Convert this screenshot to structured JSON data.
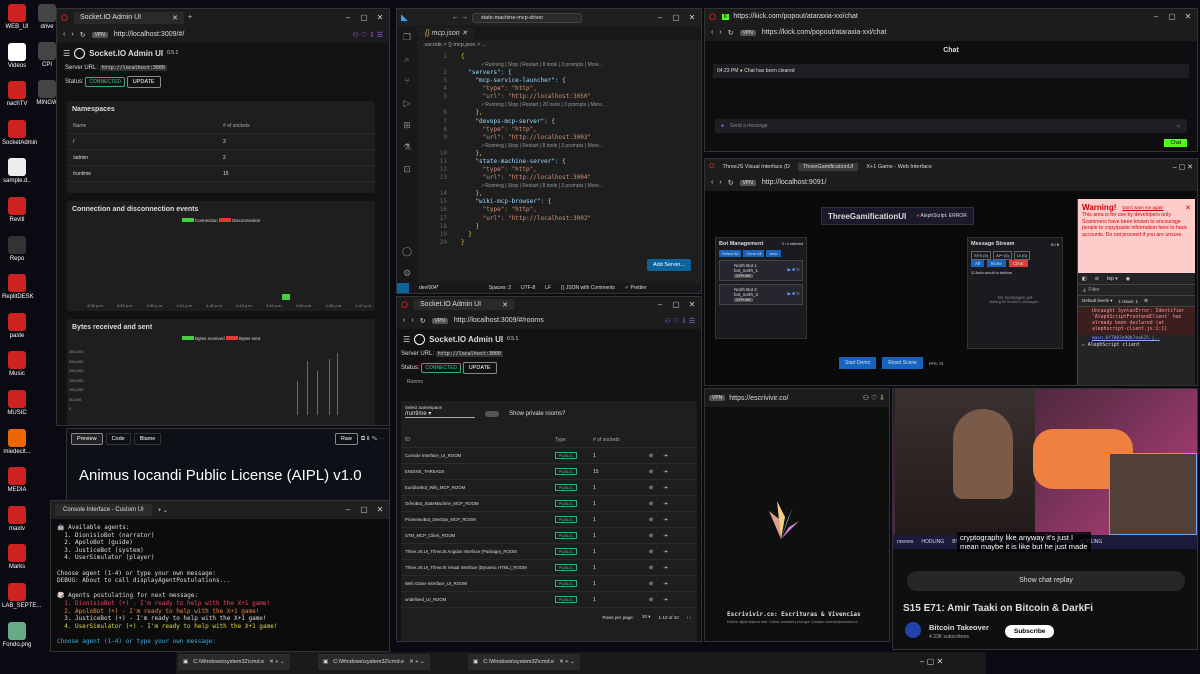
{
  "desktop": {
    "icons": [
      "WEB_UI",
      "Videos",
      "nachTV",
      "SocketAdmin",
      "sample.d..",
      "Revitl",
      "Repo",
      "ReplitDESK",
      "paste",
      "Music",
      "MUSIC",
      "miedecit...",
      "MEDIA",
      "maxtv",
      "Marks",
      "LAB_SEPTE...",
      "Fondo.png"
    ],
    "mid_icons": [
      "drive",
      "CPI",
      "MINGW"
    ]
  },
  "socket_left": {
    "tab": "Socket.IO Admin UI",
    "url": "http://localhost:3009/#/",
    "title": "Socket.IO Admin UI",
    "version": "0.5.1",
    "server_url_label": "Server URL:",
    "server_url": "http://localhost:3000",
    "status_label": "Status:",
    "status": "CONNECTED",
    "update": "UPDATE",
    "namespaces_title": "Namespaces",
    "col_name": "Name",
    "col_sockets": "# of sockets",
    "namespaces": [
      {
        "name": "/",
        "count": "3"
      },
      {
        "name": "/admin",
        "count": "2"
      },
      {
        "name": "/runtime",
        "count": "15"
      }
    ],
    "conn_title": "Connection and disconnection events",
    "legend_conn": "Connection",
    "legend_disc": "Disconnection",
    "bytes_title": "Bytes received and sent",
    "legend_recv": "Bytes received",
    "legend_sent": "Bytes sent",
    "times": [
      "4:38 p.m.",
      "4:39 p.m.",
      "4:40 p.m.",
      "4:41 p.m.",
      "4:42 p.m.",
      "4:43 p.m.",
      "4:44 p.m.",
      "4:45 p.m.",
      "4:46 p.m.",
      "4:47 p.m."
    ],
    "bytes_ticks": [
      "300,000",
      "250,000",
      "200,000",
      "150,000",
      "100,000",
      "50,000",
      "0"
    ]
  },
  "github": {
    "tab_preview": "Preview",
    "tab_code": "Code",
    "tab_blame": "Blame",
    "raw": "Raw",
    "heading": "Animus Iocandi Public License (AIPL) v1.0"
  },
  "vscode": {
    "search": "state-machine-mcp-driver",
    "tab": "mcp.json",
    "breadcrumb": ".vscode > {} mcp.json > ...",
    "lenses": [
      "✓Running | Stop | Restart | 8 tools | 3 prompts | More...",
      "✓Running | Stop | Restart | 20 tools | 3 prompts | More...",
      "✓Running | Stop | Restart | 8 tools | 3 prompts | More...",
      "✓Running | Stop | Restart | 8 tools | 3 prompts | More..."
    ],
    "lines": [
      "{",
      "  \"servers\": {",
      "    \"mcp-service-launcher\": {",
      "      \"type\": \"http\",",
      "      \"url\": \"http://localhost:3050\"",
      "    },",
      "    \"devops-mcp-server\": {",
      "      \"type\": \"http\",",
      "      \"url\": \"http://localhost:3003\"",
      "    },",
      "    \"state-machine-server\": {",
      "      \"type\": \"http\",",
      "      \"url\": \"http://localhost:3004\"",
      "    },",
      "    \"wiki-mcp-browser\": {",
      "      \"type\": \"http\",",
      "      \"url\": \"http://localhost:3002\"",
      "    }",
      "  }",
      "}"
    ],
    "add_server": "Add Server...",
    "status_branch": "dev/004*",
    "status_spaces": "Spaces: 2",
    "status_enc": "UTF-8",
    "status_eol": "LF",
    "status_lang": "{} JSON with Comments",
    "status_prettier": "✓ Prettier"
  },
  "socket_mid": {
    "tab": "Socket.IO Admin UI",
    "url": "http://localhost:3009/#/rooms",
    "title": "Socket.IO Admin UI",
    "version": "0.5.1",
    "server_url_label": "Server URL:",
    "server_url": "http://localhost:3000",
    "status_label": "Status:",
    "status": "CONNECTED",
    "update": "UPDATE",
    "section": "Rooms",
    "ns_label": "Select namespace",
    "ns_value": "/runtime",
    "private_label": "Show private rooms?",
    "col_id": "ID",
    "col_type": "Type",
    "col_sockets": "# of sockets",
    "rooms": [
      {
        "id": "Console Interface_UI_ROOM",
        "type": "PUBLIC",
        "n": "1"
      },
      {
        "id": "ENGINE_THREADS",
        "type": "PUBLIC",
        "n": "15"
      },
      {
        "id": "EuridiceBot_Wiki_MCP_ROOM",
        "type": "PUBLIC",
        "n": "1"
      },
      {
        "id": "OrfeoBot_StateMachine_MCP_ROOM",
        "type": "PUBLIC",
        "n": "1"
      },
      {
        "id": "PrometeoBot_DevOps_MCP_ROOM",
        "type": "PUBLIC",
        "n": "1"
      },
      {
        "id": "STM_MCP_Client_ROOM",
        "type": "PUBLIC",
        "n": "1"
      },
      {
        "id": "Three.JS.UI_ThreeJS Angular Interface (Package)_ROOM",
        "type": "PUBLIC",
        "n": "1"
      },
      {
        "id": "Three.JS.UI_ThreeJS Visual Interface (Dynamic HTML)_ROOM",
        "type": "PUBLIC",
        "n": "1"
      },
      {
        "id": "Web Game Interface_UI_ROOM",
        "type": "PUBLIC",
        "n": "1"
      },
      {
        "id": "undefined_UI_ROOM",
        "type": "PUBLIC",
        "n": "1"
      }
    ],
    "rows_label": "Rows per page:",
    "rows_value": "20",
    "range": "1-10 of 10"
  },
  "console": {
    "title": "Console Interface - Custom UI",
    "lines": [
      {
        "t": "🤖 Available agents:",
        "c": "#ddd"
      },
      {
        "t": "  1. DionisioBot (narrator)",
        "c": "#ddd"
      },
      {
        "t": "  2. ApoloBot (guide)",
        "c": "#ddd"
      },
      {
        "t": "  3. JusticeBot (system)",
        "c": "#ddd"
      },
      {
        "t": "  4. UserSimulator (player)",
        "c": "#ddd"
      },
      {
        "t": "",
        "c": "#ddd"
      },
      {
        "t": "Choose agent (1-4) or type your own message:",
        "c": "#ddd"
      },
      {
        "t": "DEBUG: About to call displayAgentPostulations...",
        "c": "#ddd"
      },
      {
        "t": "",
        "c": "#ddd"
      },
      {
        "t": "🎲 Agents postulating for next message:",
        "c": "#ddd"
      },
      {
        "t": "  1. DionisioBot (+) - I'm ready to help with the X+1 game!",
        "c": "#e46"
      },
      {
        "t": "  2. ApoloBot (+) - I'm ready to help with the X+1 game!",
        "c": "#e84"
      },
      {
        "t": "  3. JusticeBot (+) - I'm ready to help with the X+1 game!",
        "c": "#ddd"
      },
      {
        "t": "  4. UserSimulator (+) - I'm ready to help with the X+1 game!",
        "c": "#dd4"
      },
      {
        "t": "",
        "c": "#ddd"
      },
      {
        "t": "Choose agent (1-4) or type your own message:",
        "c": "#4ad"
      }
    ]
  },
  "kick": {
    "url": "https://kick.com/popout/ataraxia-xxi/chat",
    "heading": "Chat",
    "time": "04:23 PM",
    "msg": "Chat has been cleared",
    "placeholder": "Send a message",
    "chat_btn": "Chat"
  },
  "three": {
    "tabs": [
      "ThreeJS Visual Interface (D",
      "ThreeGamificationUI",
      "X+1 Game - Web Interface"
    ],
    "url": "http://localhost:9091/",
    "title": "ThreeGamificationUI",
    "status": "AlephScript: ERROR",
    "bot_title": "Bot Management",
    "bot_count": "0 / 4 selected",
    "bot_btns": [
      "Select All",
      "Clear All",
      "Auto"
    ],
    "bots": [
      {
        "name": "North Bot 1",
        "sub": "bot_north_1",
        "state": "OFFLINE"
      },
      {
        "name": "North Bot 2",
        "sub": "bot_north_2",
        "state": "OFFLINE"
      }
    ],
    "stream_title": "Message Stream",
    "stream_count": "0 / 0",
    "filters": [
      "SYS (0)",
      "AI** (0)",
      "UI (0)"
    ],
    "stream_btns": [
      "All",
      "None",
      "Clear"
    ],
    "autoscroll": "Auto-scroll to bottom",
    "no_msgs": "No messages yet",
    "waiting": "Waiting for Socket.io messages...",
    "start": "Start Demo",
    "reset": "Reset Scene",
    "fps": "FPS: 73",
    "warn_title": "Warning!",
    "warn_link": "Don't warn me again",
    "warn_body": "This area is for use by developers only. Scammers have been known to encourage people to copy/paste information here to hack accounts. Do not proceed if you are unsure.",
    "dt_top": "top",
    "dt_filter": "Filter",
    "dt_levels": "Default levels",
    "dt_issues": "1 Issue: 1",
    "err": "Uncaught SyntaxError: Identifier 'AlephScriptFrontendClient' has already been declared (at alephscript-client.js:1:1)",
    "err_file": "main.6f7002e90b7ea625.j..",
    "err_client": "AlephScript client"
  },
  "escrivivir": {
    "url": "https://escrivivir.co/",
    "brand": "Escrivivir.co: Escrituras & Vivencias",
    "tagline": "Entorno digital dejamos este. Cultura, sociedad y ecología. Contacto: escrivivir@escrivivir.co"
  },
  "yt": {
    "caption1": "cryptography like anyway it's just I",
    "caption2": "mean maybe it is like but he just made",
    "chat_replay": "Show chat replay",
    "title": "S15 E71: Amir Taaki on Bitcoin & DarkFi",
    "channel": "Bitcoin Takeover",
    "subs": "4.33K subscribers",
    "subscribe": "Subscribe",
    "sponsors": [
      "noones",
      "HODLING",
      "BTCTKVR",
      "HODLING",
      "BTC4SHIFT.AI",
      "noones",
      "HODLING"
    ]
  },
  "taskbar": {
    "items": [
      "C:\\Windows\\system32\\cmd.e",
      "C:\\Windows\\system32\\cmd.e",
      "C:\\Windows\\system32\\cmd.e"
    ]
  },
  "colors": {
    "opera_red": "#e0202a",
    "connected": "#33bb66",
    "bar_red": "#e53935",
    "kick_green": "#53fc18",
    "vpn": "#555"
  }
}
